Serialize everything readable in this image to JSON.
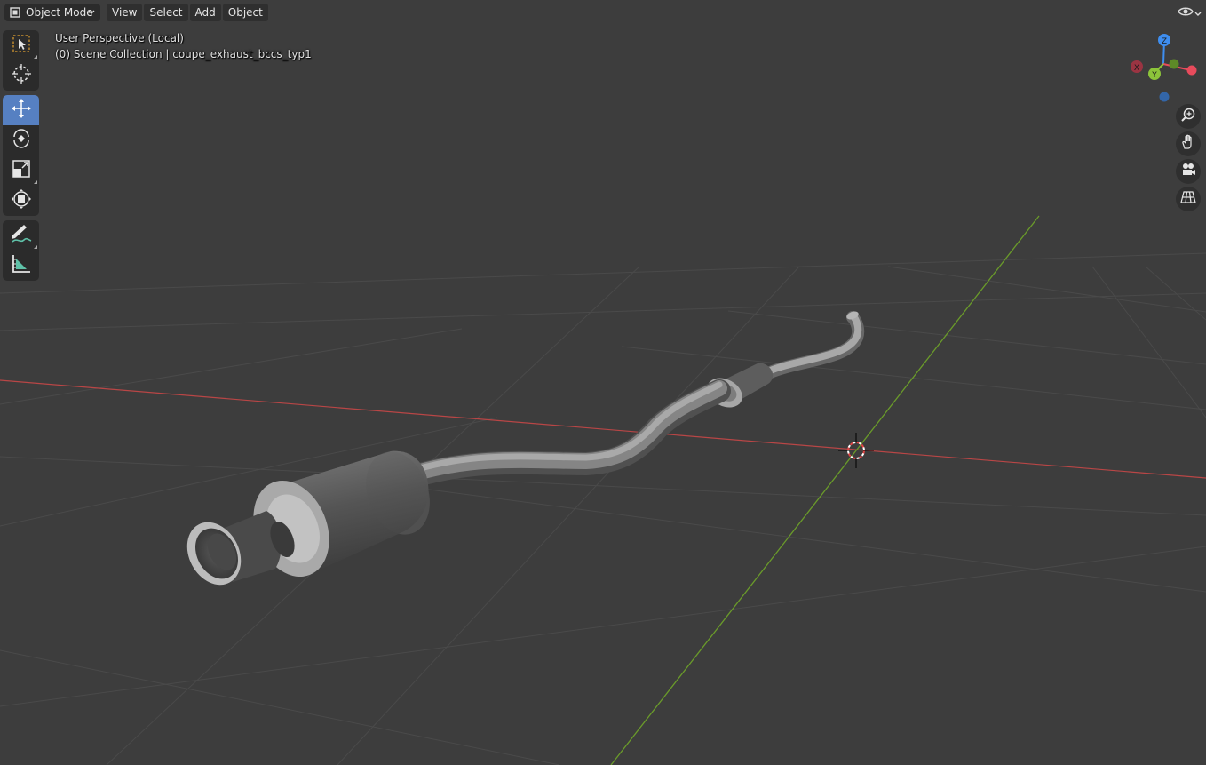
{
  "header": {
    "mode_label": "Object Mode",
    "menu": [
      "View",
      "Select",
      "Add",
      "Object"
    ]
  },
  "toolbar": {
    "tools": [
      "select-box",
      "cursor",
      "move",
      "rotate",
      "scale",
      "transform",
      "annotate",
      "measure"
    ],
    "active_tool": "move"
  },
  "viewport": {
    "perspective_label": "User Perspective (Local)",
    "collection_label": "(0) Scene Collection | coupe_exhaust_bccs_typ1"
  },
  "gizmo": {
    "axes": [
      "Z",
      "X",
      "Y"
    ],
    "colors": {
      "x": "#e84b5c",
      "y": "#8cc43a",
      "z": "#3e8ef0",
      "x_neg": "#9a3442",
      "y_neg": "#5d8a27",
      "z_neg": "#3366a8"
    }
  },
  "nav_buttons": [
    "zoom-icon",
    "hand-pan-icon",
    "camera-icon",
    "grid-ortho-icon"
  ],
  "colors": {
    "background": "#3d3d3d",
    "grid": "#4a4a4a",
    "x_axis": "#b94646",
    "y_axis": "#6a9b2a",
    "active_tool": "#5680c2"
  }
}
